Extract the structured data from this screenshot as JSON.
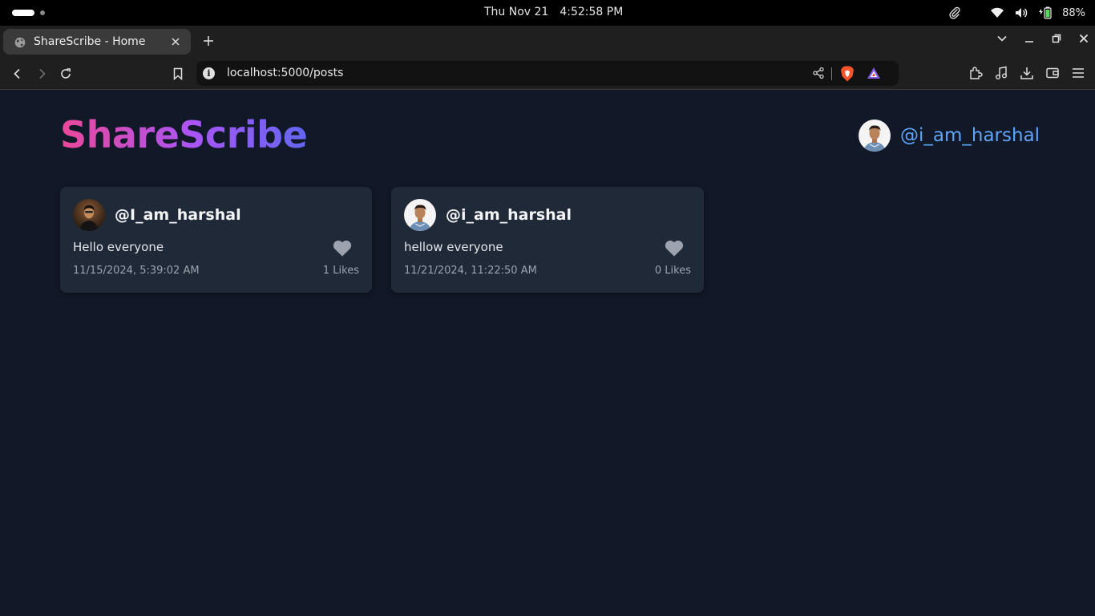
{
  "os": {
    "date": "Thu Nov 21",
    "time": "4:52:58 PM",
    "battery": "88%"
  },
  "browser": {
    "tab_title": "ShareScribe - Home",
    "url": "localhost:5000/posts"
  },
  "app": {
    "logo": "ShareScribe",
    "current_user": "@i_am_harshal",
    "accent": "#60a5fa"
  },
  "posts": [
    {
      "handle": "@I_am_harshal",
      "content": "Hello everyone",
      "timestamp": "11/15/2024, 5:39:02 AM",
      "likes": "1 Likes"
    },
    {
      "handle": "@i_am_harshal",
      "content": "hellow everyone",
      "timestamp": "11/21/2024, 11:22:50 AM",
      "likes": "0 Likes"
    }
  ]
}
